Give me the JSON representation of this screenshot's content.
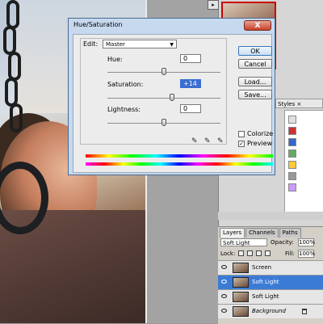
{
  "dialog": {
    "title": "Hue/Saturation",
    "close_label": "X",
    "edit_label": "Edit:",
    "edit_value": "Master",
    "params": [
      {
        "label": "Hue:",
        "value": "0",
        "level": 0
      },
      {
        "label": "Saturation:",
        "value": "+14",
        "level": 14
      },
      {
        "label": "Lightness:",
        "value": "0",
        "level": 0
      }
    ],
    "buttons": {
      "ok": "OK",
      "cancel": "Cancel",
      "load": "Load...",
      "save": "Save..."
    },
    "colorize": {
      "label": "Colorize",
      "checked": false
    },
    "preview": {
      "label": "Preview",
      "checked": true
    }
  },
  "styles_panel": {
    "tab_label": "Styles"
  },
  "layers_panel": {
    "tabs": [
      "Layers",
      "Channels",
      "Paths"
    ],
    "blend_mode": "Soft Light",
    "opacity_label": "Opacity:",
    "opacity_value": "100%",
    "lock_label": "Lock:",
    "fill_label": "Fill:",
    "fill_value": "100%",
    "layers": [
      {
        "name": "Screen",
        "selected": false
      },
      {
        "name": "Soft Light",
        "selected": true
      },
      {
        "name": "Soft Light",
        "selected": false
      },
      {
        "name": "Background",
        "selected": false,
        "locked": true
      }
    ]
  }
}
